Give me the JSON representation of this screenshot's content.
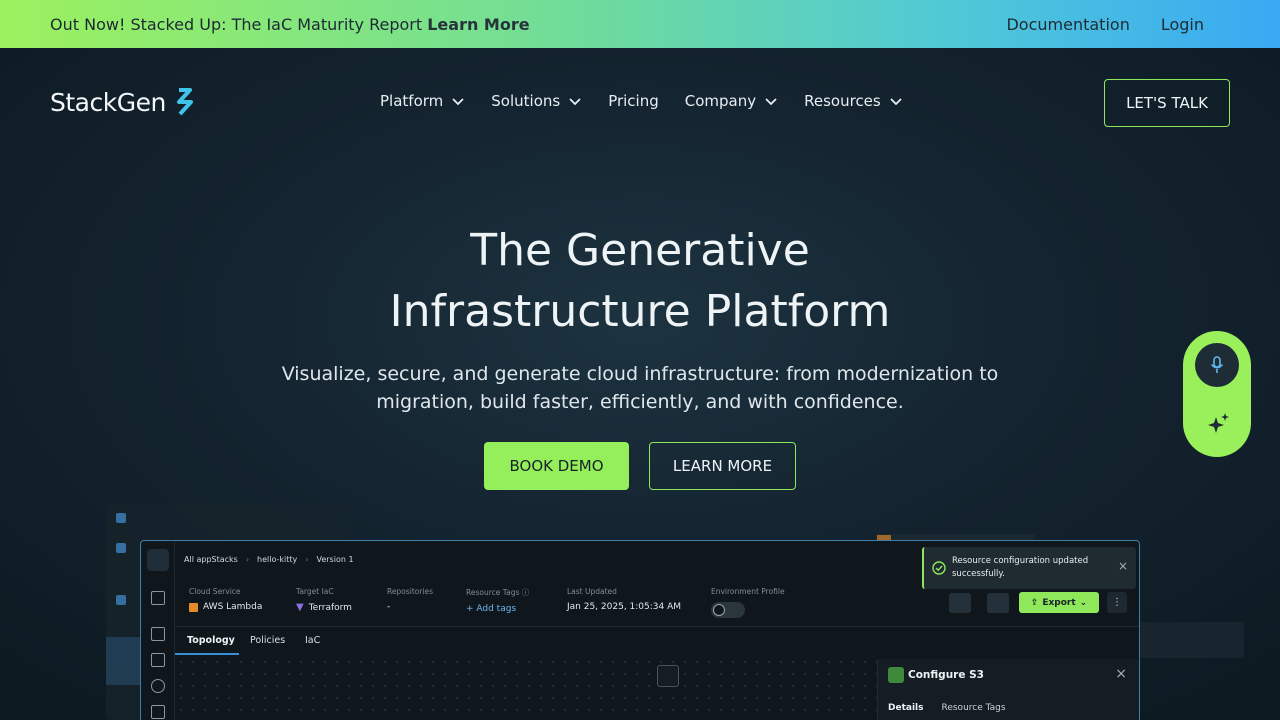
{
  "announcement": {
    "text": "Out Now! Stacked Up: The IaC Maturity Report ",
    "link": "Learn More",
    "documentation": "Documentation",
    "login": "Login"
  },
  "nav": {
    "logo": "StackGen",
    "items": [
      "Platform",
      "Solutions",
      "Pricing",
      "Company",
      "Resources"
    ],
    "cta": "LET'S TALK"
  },
  "hero": {
    "title_line1": "The Generative",
    "title_line2": "Infrastructure Platform",
    "subtitle": "Visualize, secure, and generate cloud infrastructure: from modernization to migration, build faster, efficiently, and with confidence.",
    "primary_cta": "BOOK DEMO",
    "secondary_cta": "LEARN MORE"
  },
  "app_preview": {
    "breadcrumbs": [
      "All appStacks",
      "hello-kitty",
      "Version 1"
    ],
    "meta": [
      {
        "label": "Cloud Service",
        "value": "AWS Lambda"
      },
      {
        "label": "Target IaC",
        "value": "Terraform"
      },
      {
        "label": "Repositories",
        "value": "-"
      },
      {
        "label": "Resource Tags",
        "value": "+ Add tags"
      },
      {
        "label": "Last Updated",
        "value": "Jan 25, 2025, 1:05:34 AM"
      },
      {
        "label": "Environment Profile",
        "value": ""
      }
    ],
    "tabs": [
      "Topology",
      "Policies",
      "IaC"
    ],
    "export": "Export",
    "toast": "Resource configuration updated successfully.",
    "panel_title": "Configure S3",
    "panel_tabs": [
      "Details",
      "Resource Tags"
    ]
  },
  "colors": {
    "accent_green": "#95ef5a",
    "link_blue": "#3a8fd6"
  }
}
